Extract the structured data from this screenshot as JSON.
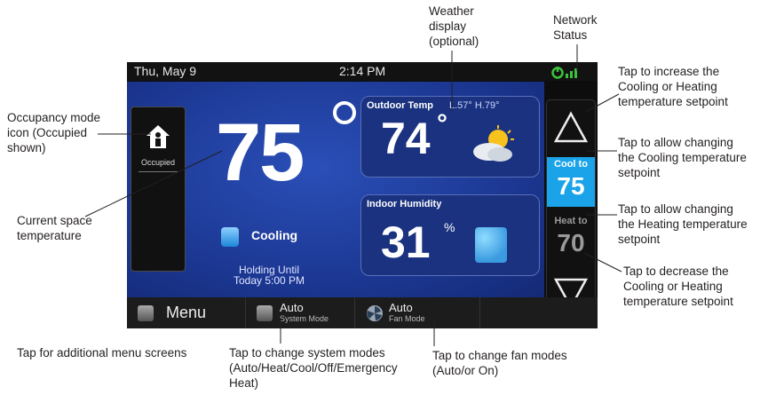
{
  "status_bar": {
    "date": "Thu, May 9",
    "time": "2:14 PM"
  },
  "current_temp": "75",
  "occupancy": {
    "label": "Occupied"
  },
  "system_status": {
    "label": "Cooling",
    "hold_line1": "Holding Until",
    "hold_line2": "Today 5:00 PM"
  },
  "outdoor": {
    "title": "Outdoor Temp",
    "range": "L.57° H.79°",
    "value": "74",
    "degree": "°"
  },
  "humidity": {
    "title": "Indoor Humidity",
    "value": "31",
    "unit": "%"
  },
  "setpoints": {
    "cool_label": "Cool to",
    "cool_value": "75",
    "heat_label": "Heat to",
    "heat_value": "70"
  },
  "bottom_bar": {
    "menu_label": "Menu",
    "system_mode_value": "Auto",
    "system_mode_label": "System Mode",
    "fan_mode_value": "Auto",
    "fan_mode_label": "Fan Mode"
  },
  "callouts": {
    "weather": [
      "Weather",
      "display",
      "(optional)"
    ],
    "network": [
      "Network",
      "Status"
    ],
    "occupancy": [
      "Occupancy mode",
      "icon (Occupied",
      "shown)"
    ],
    "current_temp": [
      "Current space",
      "temperature"
    ],
    "increase": [
      "Tap to increase the",
      "Cooling or Heating",
      "temperature setpoint"
    ],
    "cool": [
      "Tap to allow changing",
      "the Cooling temperature",
      "setpoint"
    ],
    "heat": [
      "Tap to allow changing",
      "the Heating temperature",
      "setpoint"
    ],
    "decrease": [
      "Tap to decrease the",
      "Cooling or Heating",
      "temperature setpoint"
    ],
    "menu": [
      "Tap for additional menu screens"
    ],
    "system_modes": [
      "Tap to change system modes",
      "(Auto/Heat/Cool/Off/Emergency",
      "Heat)"
    ],
    "fan_modes": [
      "Tap to change fan modes",
      "(Auto/or On)"
    ]
  },
  "colors": {
    "screen_blue": "#1d3b95",
    "cool_accent": "#1aa3e8",
    "network_green": "#3bc43b"
  }
}
